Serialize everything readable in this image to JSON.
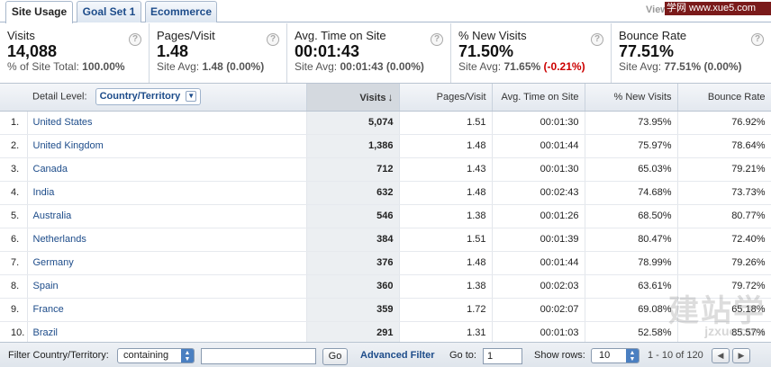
{
  "tabs": [
    {
      "label": "Site Usage"
    },
    {
      "label": "Goal Set 1"
    },
    {
      "label": "Ecommerce"
    }
  ],
  "view_label": "View",
  "watermark_top": "学网 www.xue5.com",
  "scorecards": [
    {
      "label": "Visits",
      "value": "14,088",
      "sub_prefix": "% of Site Total:",
      "sub_value": "100.00%",
      "sub_delta": ""
    },
    {
      "label": "Pages/Visit",
      "value": "1.48",
      "sub_prefix": "Site Avg:",
      "sub_value": "1.48 (0.00%)",
      "sub_delta": ""
    },
    {
      "label": "Avg. Time on Site",
      "value": "00:01:43",
      "sub_prefix": "Site Avg:",
      "sub_value": "00:01:43 (0.00%)",
      "sub_delta": ""
    },
    {
      "label": "% New Visits",
      "value": "71.50%",
      "sub_prefix": "Site Avg:",
      "sub_value": "71.65%",
      "sub_delta": "(-0.21%)"
    },
    {
      "label": "Bounce Rate",
      "value": "77.51%",
      "sub_prefix": "Site Avg:",
      "sub_value": "77.51% (0.00%)",
      "sub_delta": ""
    }
  ],
  "help_glyph": "?",
  "table": {
    "detail_level_label": "Detail Level:",
    "detail_level_value": "Country/Territory",
    "columns": [
      "Visits",
      "Pages/Visit",
      "Avg. Time on Site",
      "% New Visits",
      "Bounce Rate"
    ],
    "sort_arrow": "↓",
    "rows": [
      {
        "rank": "1.",
        "country": "United States",
        "visits": "5,074",
        "pages": "1.51",
        "time": "00:01:30",
        "new": "73.95%",
        "bounce": "76.92%"
      },
      {
        "rank": "2.",
        "country": "United Kingdom",
        "visits": "1,386",
        "pages": "1.48",
        "time": "00:01:44",
        "new": "75.97%",
        "bounce": "78.64%"
      },
      {
        "rank": "3.",
        "country": "Canada",
        "visits": "712",
        "pages": "1.43",
        "time": "00:01:30",
        "new": "65.03%",
        "bounce": "79.21%"
      },
      {
        "rank": "4.",
        "country": "India",
        "visits": "632",
        "pages": "1.48",
        "time": "00:02:43",
        "new": "74.68%",
        "bounce": "73.73%"
      },
      {
        "rank": "5.",
        "country": "Australia",
        "visits": "546",
        "pages": "1.38",
        "time": "00:01:26",
        "new": "68.50%",
        "bounce": "80.77%"
      },
      {
        "rank": "6.",
        "country": "Netherlands",
        "visits": "384",
        "pages": "1.51",
        "time": "00:01:39",
        "new": "80.47%",
        "bounce": "72.40%"
      },
      {
        "rank": "7.",
        "country": "Germany",
        "visits": "376",
        "pages": "1.48",
        "time": "00:01:44",
        "new": "78.99%",
        "bounce": "79.26%"
      },
      {
        "rank": "8.",
        "country": "Spain",
        "visits": "360",
        "pages": "1.38",
        "time": "00:02:03",
        "new": "63.61%",
        "bounce": "79.72%"
      },
      {
        "rank": "9.",
        "country": "France",
        "visits": "359",
        "pages": "1.72",
        "time": "00:02:07",
        "new": "69.08%",
        "bounce": "65.18%"
      },
      {
        "rank": "10.",
        "country": "Brazil",
        "visits": "291",
        "pages": "1.31",
        "time": "00:01:03",
        "new": "52.58%",
        "bounce": "85.57%"
      }
    ]
  },
  "footer": {
    "filter_label": "Filter Country/Territory:",
    "filter_mode": "containing",
    "filter_value": "",
    "go_label": "Go",
    "advanced_filter": "Advanced Filter",
    "goto_label": "Go to:",
    "goto_value": "1",
    "show_rows_label": "Show rows:",
    "show_rows_value": "10",
    "range": "1 - 10 of 120",
    "prev": "◀",
    "next": "▶"
  },
  "watermark_logo": "建站学",
  "watermark_url": "jzxue.com"
}
